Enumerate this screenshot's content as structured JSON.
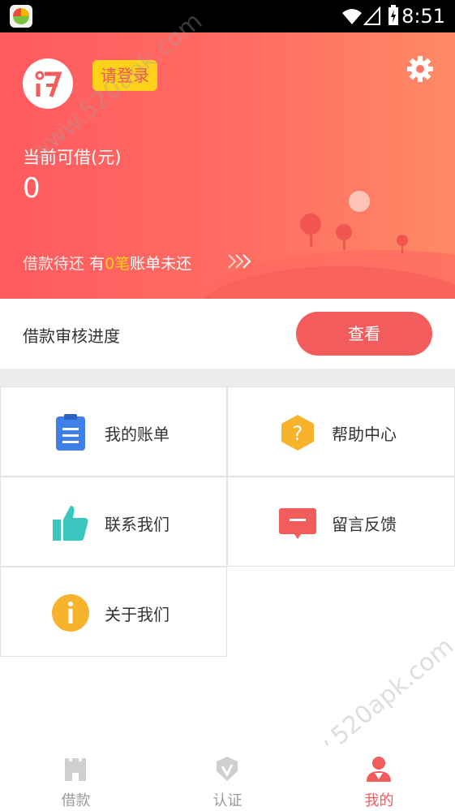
{
  "status_bar": {
    "time": "8:51"
  },
  "header": {
    "login_label": "请登录",
    "limit_label": "当前可借(元)",
    "limit_value": "0",
    "repay_prefix": "借款待还",
    "repay_have": "有",
    "repay_count": "0笔",
    "repay_suffix": "账单未还"
  },
  "progress": {
    "label": "借款审核进度",
    "button_label": "查看"
  },
  "menu": {
    "items": [
      {
        "label": "我的账单",
        "icon": "bill-icon",
        "color": "#3f7fe8"
      },
      {
        "label": "帮助中心",
        "icon": "help-icon",
        "color": "#f7b32b"
      },
      {
        "label": "联系我们",
        "icon": "thumbs-up-icon",
        "color": "#3cc6c0"
      },
      {
        "label": "留言反馈",
        "icon": "message-icon",
        "color": "#f25c5c"
      },
      {
        "label": "关于我们",
        "icon": "info-icon",
        "color": "#f7b32b"
      }
    ]
  },
  "tabbar": {
    "tabs": [
      {
        "label": "借款",
        "icon": "loan-icon"
      },
      {
        "label": "认证",
        "icon": "verify-icon"
      },
      {
        "label": "我的",
        "icon": "profile-icon",
        "active": true
      }
    ]
  },
  "watermark": {
    "text": "www.520apk.com"
  },
  "colors": {
    "accent": "#f25c5c",
    "badge": "#ffd21a"
  }
}
